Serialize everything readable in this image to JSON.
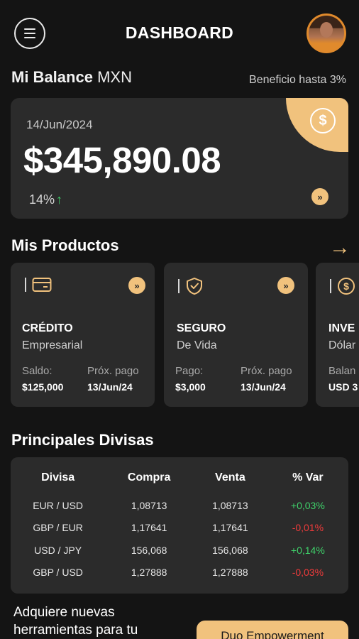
{
  "header": {
    "title": "DASHBOARD",
    "menu_icon": "hamburger-menu-icon",
    "avatar": "user-avatar"
  },
  "balance": {
    "label": "Mi Balance",
    "currency": "MXN",
    "benefit": "Beneficio hasta 3%",
    "date": "14/Jun/2024",
    "amount": "$345,890.08",
    "change": "14%",
    "change_icon": "↑",
    "accent_color": "#f1c27d"
  },
  "products": {
    "title": "Mis Productos",
    "arrow": "→",
    "items": [
      {
        "icon": "credit-card-icon",
        "name": "CRÉDITO",
        "sub": "Empresarial",
        "label1": "Saldo:",
        "value1": "$125,000",
        "label2": "Próx. pago",
        "value2": "13/Jun/24"
      },
      {
        "icon": "shield-check-icon",
        "name": "SEGURO",
        "sub": "De Vida",
        "label1": "Pago:",
        "value1": "$3,000",
        "label2": "Próx. pago",
        "value2": "13/Jun/24"
      },
      {
        "icon": "dollar-coin-icon",
        "name": "INVE",
        "sub": "Dólar",
        "label1": "Balan",
        "value1": "USD 3"
      }
    ]
  },
  "currencies": {
    "title": "Principales Divisas",
    "headers": [
      "Divisa",
      "Compra",
      "Venta",
      "% Var"
    ],
    "rows": [
      {
        "pair": "EUR / USD",
        "buy": "1,08713",
        "sell": "1,08713",
        "var": "+0,03%",
        "trend": "up"
      },
      {
        "pair": "GBP / EUR",
        "buy": "1,17641",
        "sell": "1,17641",
        "var": "-0,01%",
        "trend": "down"
      },
      {
        "pair": "USD / JPY",
        "buy": "156,068",
        "sell": "156,068",
        "var": "+0,14%",
        "trend": "up"
      },
      {
        "pair": "GBP / USD",
        "buy": "1,27888",
        "sell": "1,27888",
        "var": "-0,03%",
        "trend": "down"
      }
    ],
    "positive_color": "#3fd16a",
    "negative_color": "#ef3b3b"
  },
  "promo": {
    "text": "Adquiere nuevas herramientas para tu",
    "button": "Duo Empowerment"
  }
}
